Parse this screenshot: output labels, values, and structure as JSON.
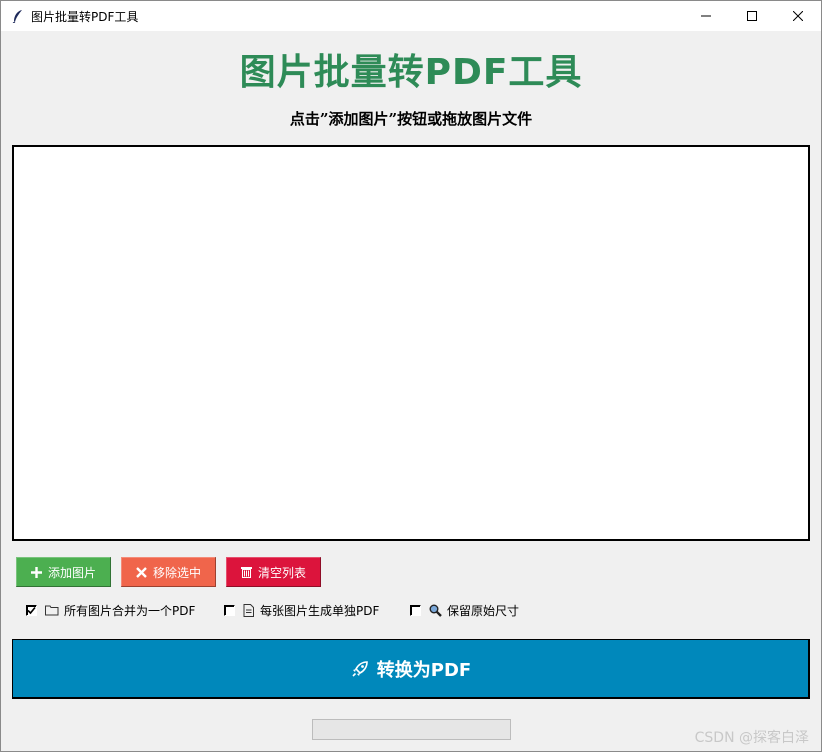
{
  "window": {
    "title": "图片批量转PDF工具",
    "icon": "feather-icon"
  },
  "header": {
    "title": "图片批量转PDF工具",
    "title_color": "#2e8b57",
    "subtitle": "点击”添加图片”按钮或拖放图片文件"
  },
  "buttons": {
    "add": {
      "icon": "plus-icon",
      "label": "添加图片",
      "color": "#4caf50"
    },
    "remove": {
      "icon": "x-icon",
      "label": "移除选中",
      "color": "#f0654b"
    },
    "clear": {
      "icon": "trash-icon",
      "label": "清空列表",
      "color": "#dc143c"
    }
  },
  "options": [
    {
      "icon": "folder-icon",
      "label": "所有图片合并为一个PDF",
      "checked": true
    },
    {
      "icon": "document-icon",
      "label": "每张图片生成单独PDF",
      "checked": false
    },
    {
      "icon": "magnifier-icon",
      "label": "保留原始尺寸",
      "checked": false
    }
  ],
  "convert": {
    "icon": "rocket-icon",
    "label": "转换为PDF",
    "color": "#0088bb"
  },
  "progress": {
    "value": 0
  },
  "watermark": "CSDN @探客白泽"
}
